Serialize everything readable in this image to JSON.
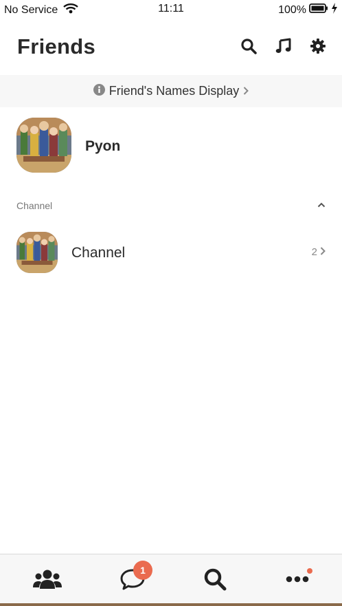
{
  "status_bar": {
    "carrier": "No Service",
    "time": "11:11",
    "battery": "100%"
  },
  "header": {
    "title": "Friends",
    "icons": [
      "search-icon",
      "music-note-icon",
      "gear-icon"
    ]
  },
  "banner": {
    "label": "Friend's Names Display"
  },
  "profile": {
    "name": "Pyon"
  },
  "section": {
    "label": "Channel"
  },
  "channel": {
    "name": "Channel",
    "count": "2"
  },
  "tab_bar": {
    "tabs": [
      "friends-icon",
      "chat-icon",
      "search-icon",
      "more-icon"
    ],
    "chat_badge": "1"
  },
  "colors": {
    "accent": "#ea6b4f",
    "text": "#2a2a2a",
    "banner_bg": "#f7f7f7"
  }
}
